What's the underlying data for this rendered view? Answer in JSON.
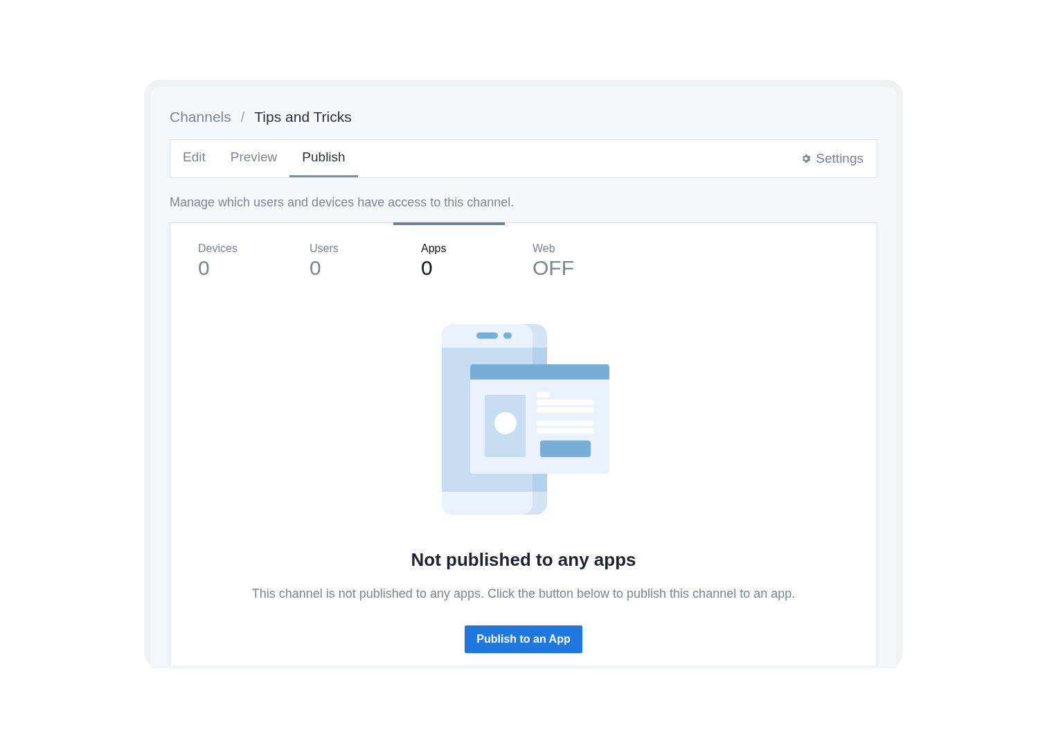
{
  "breadcrumb": [
    {
      "label": "Channels",
      "kind": "link"
    },
    {
      "label": "/",
      "kind": "separator"
    },
    {
      "label": "Tips and Tricks",
      "kind": "current"
    }
  ],
  "tabs": [
    {
      "label": "Edit",
      "selected": false
    },
    {
      "label": "Preview",
      "selected": false
    },
    {
      "label": "Publish",
      "selected": true
    }
  ],
  "settings": {
    "label": "Settings"
  },
  "description": "Manage which users and devices have access to this channel.",
  "stats": [
    {
      "label": "Devices",
      "value": "0",
      "selected": false
    },
    {
      "label": "Users",
      "value": "0",
      "selected": false
    },
    {
      "label": "Apps",
      "value": "0",
      "selected": true
    },
    {
      "label": "Web",
      "value": "OFF",
      "selected": false
    }
  ],
  "empty_state": {
    "title": "Not published to any apps",
    "message": "This channel is not published to any apps. Click the button below to publish this channel to an app.",
    "button": "Publish to an App"
  }
}
